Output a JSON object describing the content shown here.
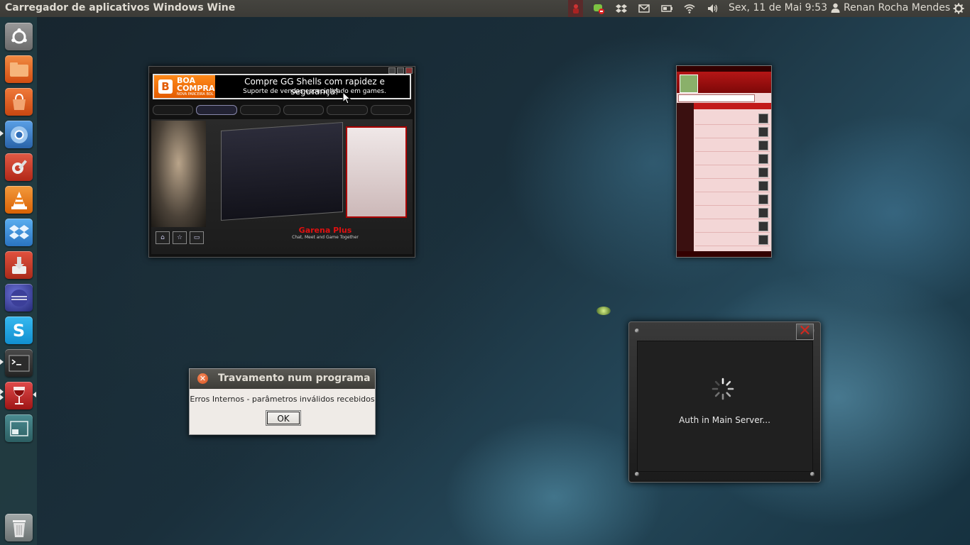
{
  "top_panel": {
    "app_title": "Carregador de aplicativos Windows Wine",
    "indicators": [
      "app-indicator-icon",
      "chat-icon",
      "dropbox-icon",
      "mail-icon",
      "battery-icon",
      "wifi-icon",
      "volume-icon"
    ],
    "clock": "Sex, 11 de Mai  9:53",
    "user": "Renan Rocha Mendes",
    "session_icon": "gear-icon"
  },
  "launcher": {
    "items": [
      {
        "name": "ubuntu-dash-icon",
        "color": "#8a8a8a"
      },
      {
        "name": "files-icon",
        "color": "#e35b1a"
      },
      {
        "name": "software-center-icon",
        "color": "#e0601a"
      },
      {
        "name": "chromium-icon",
        "color": "#3c82cf"
      },
      {
        "name": "system-settings-icon",
        "color": "#d23a2a"
      },
      {
        "name": "vlc-icon",
        "color": "#f07c10"
      },
      {
        "name": "dropbox-icon",
        "color": "#3a8fd9"
      },
      {
        "name": "update-manager-icon",
        "color": "#c33b2b"
      },
      {
        "name": "eclipse-icon",
        "color": "#3a3f8f"
      },
      {
        "name": "skype-icon",
        "color": "#1ea7e4"
      },
      {
        "name": "terminal-icon",
        "color": "#2d2d2d"
      },
      {
        "name": "wine-icon",
        "color": "#c42a2a"
      },
      {
        "name": "workspace-switcher-icon",
        "color": "#3b7b80"
      },
      {
        "name": "trash-icon",
        "color": "#8a8f8f"
      }
    ]
  },
  "garena_window": {
    "banner_brand_line1": "BOA",
    "banner_brand_line2": "COMPRA",
    "banner_brand_line3": "NOVA PARCEIRA BOL",
    "banner_text1": "Compre GG Shells com rapidez e segurança!",
    "banner_text2": "Suporte de vendas especializado em games.",
    "brand_name": "Garena Plus",
    "brand_tagline": "Chat, Meet and Game Together"
  },
  "auth_window": {
    "status": "Auth in Main Server..."
  },
  "crash_dialog": {
    "title": "Travamento num programa",
    "message": "Erros Internos - parâmetros inválidos recebidos",
    "ok_label": "OK"
  }
}
